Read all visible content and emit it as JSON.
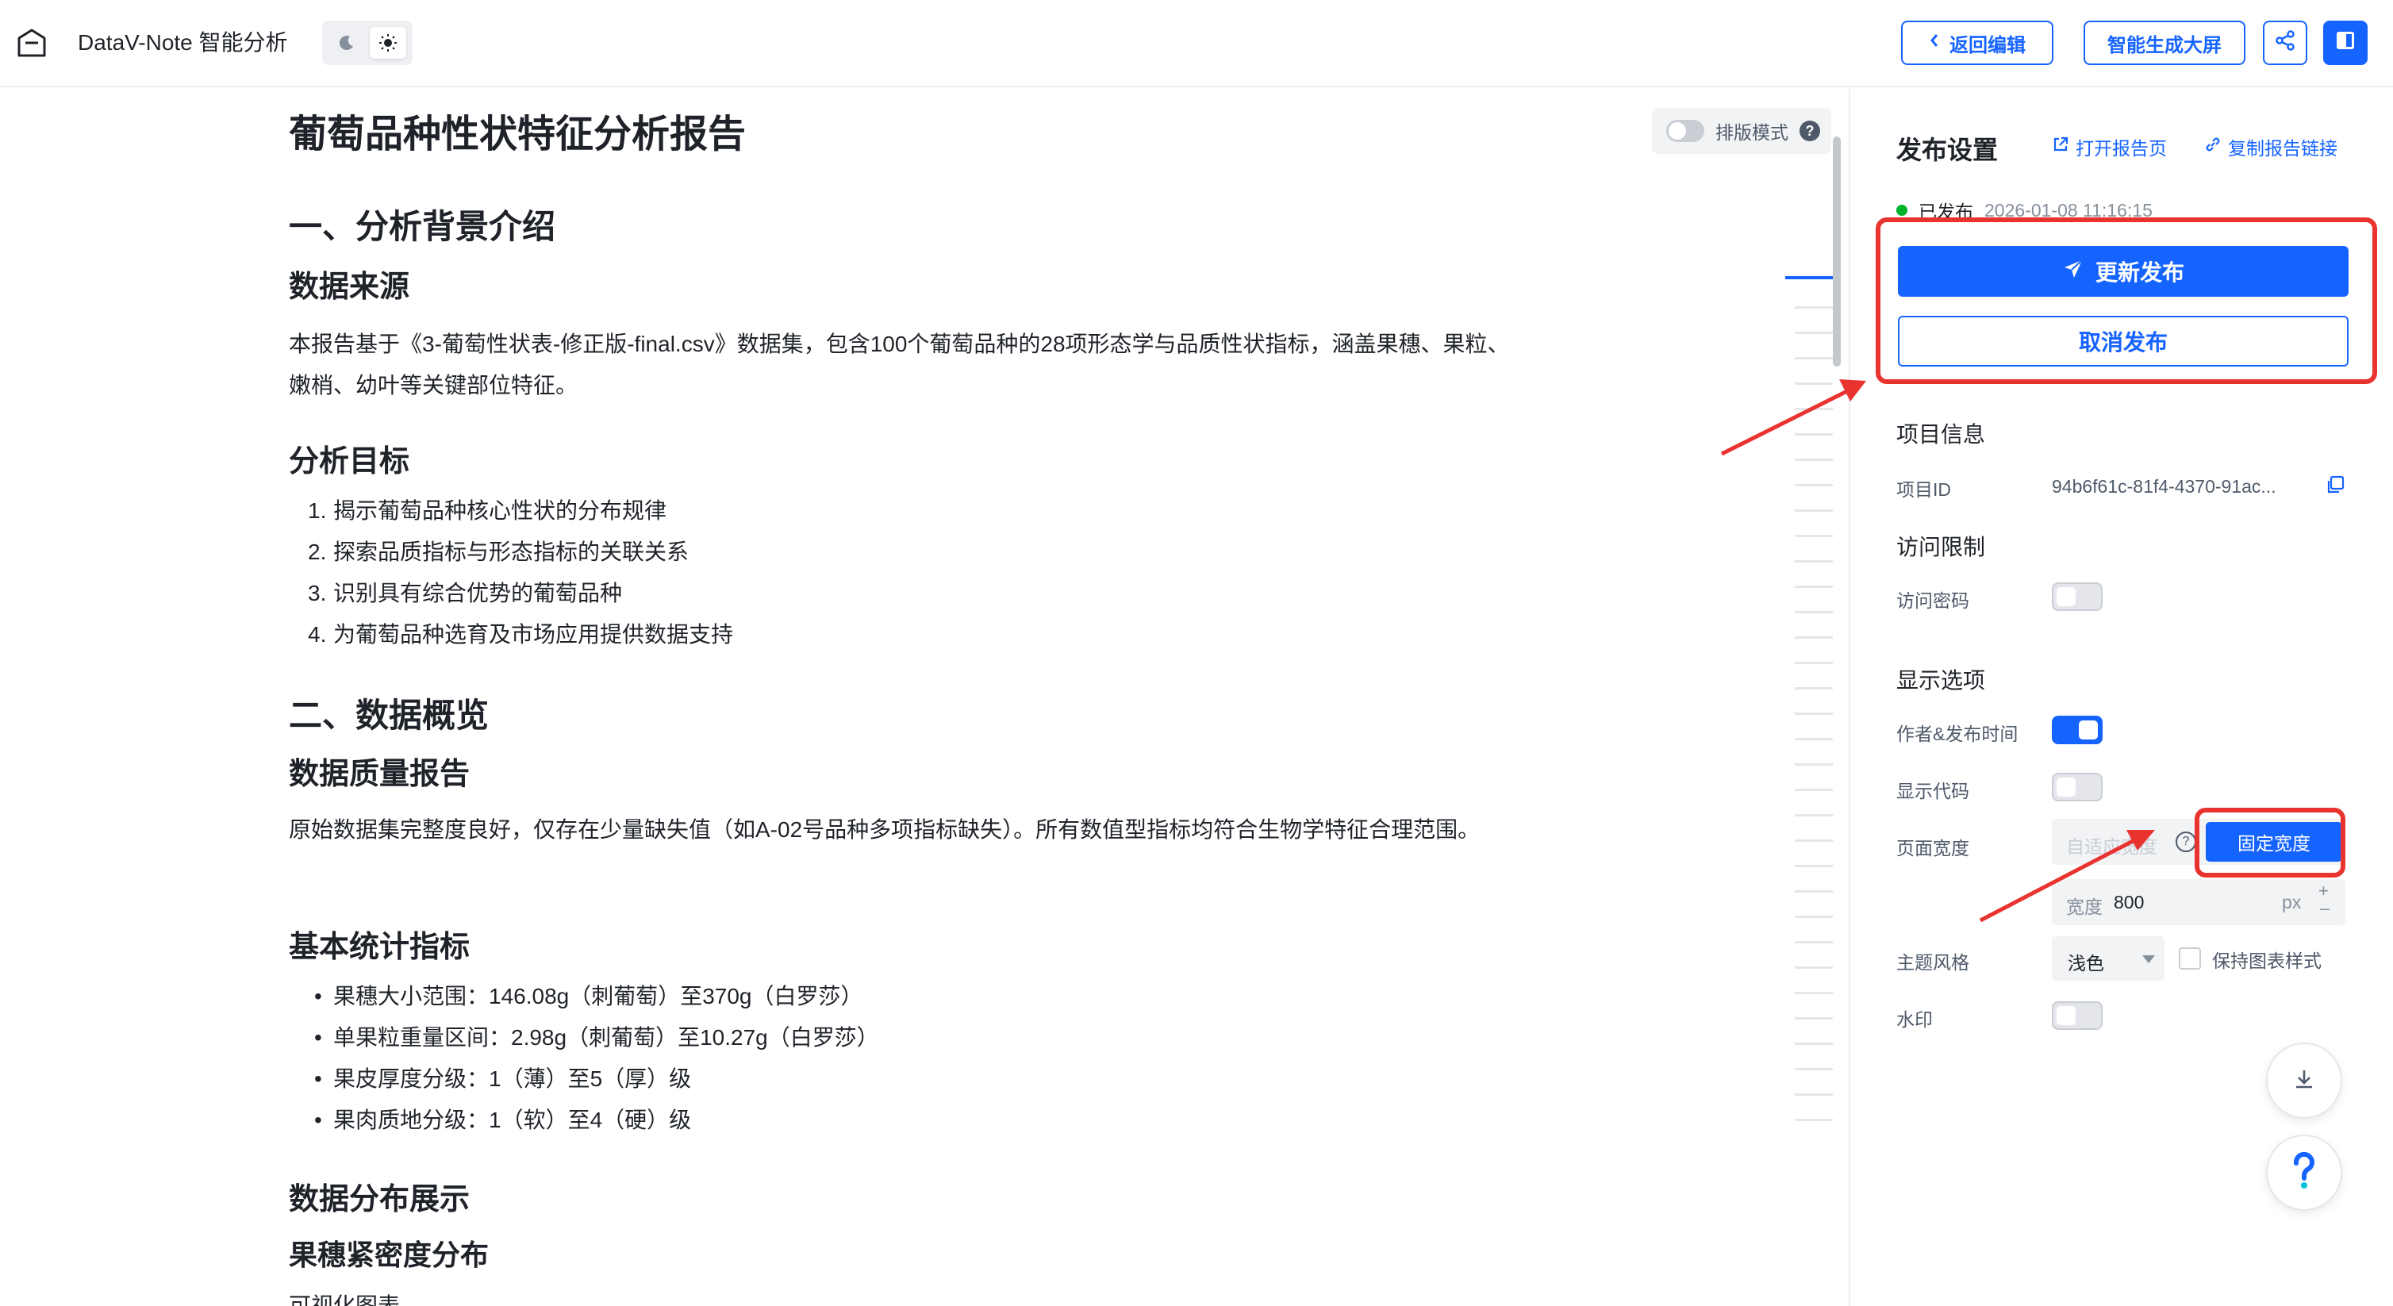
{
  "app": {
    "title": "DataV-Note 智能分析",
    "theme_options": [
      "moon-icon",
      "sun-icon"
    ],
    "theme_selected": "light"
  },
  "toolbar": {
    "back_label": "返回编辑",
    "screen_label": "智能生成大屏",
    "share_icon": "share-icon",
    "panel_icon": "panel-toggle-icon"
  },
  "article": {
    "layout_mode_label": "排版模式",
    "title": "葡萄品种性状特征分析报告",
    "section1": "一、分析背景介绍",
    "source_heading": "数据来源",
    "source_text": "本报告基于《3-葡萄性状表-修正版-final.csv》数据集，包含100个葡萄品种的28项形态学与品质性状指标，涵盖果穗、果粒、嫩梢、幼叶等关键部位特征。",
    "goal_heading": "分析目标",
    "goals": [
      {
        "num": "1.",
        "text": "揭示葡萄品种核心性状的分布规律"
      },
      {
        "num": "2.",
        "text": "探索品质指标与形态指标的关联关系"
      },
      {
        "num": "3.",
        "text": "识别具有综合优势的葡萄品种"
      },
      {
        "num": "4.",
        "text": "为葡萄品种选育及市场应用提供数据支持"
      }
    ],
    "section2": "二、数据概览",
    "quality_heading": "数据质量报告",
    "quality_text": "原始数据集完整度良好，仅存在少量缺失值（如A-02号品种多项指标缺失）。所有数值型指标均符合生物学特征合理范围。",
    "stats_heading": "基本统计指标",
    "stats": [
      "果穗大小范围：146.08g（刺葡萄）至370g（白罗莎）",
      "单果粒重量区间：2.98g（刺葡萄）至10.27g（白罗莎）",
      "果皮厚度分级：1（薄）至5（厚）级",
      "果肉质地分级：1（软）至4（硬）级"
    ],
    "dist_heading": "数据分布展示",
    "density_heading": "果穗紧密度分布",
    "chart_caption": "可视化图表"
  },
  "panel": {
    "title": "发布设置",
    "open_link": "打开报告页",
    "copy_link": "复制报告链接",
    "status_label": "已发布",
    "status_time": "2026-01-08 11:16:15",
    "update_btn": "更新发布",
    "cancel_btn": "取消发布",
    "project_info_title": "项目信息",
    "project_id_label": "项目ID",
    "project_id_value": "94b6f61c-81f4-4370-91ac...",
    "access_title": "访问限制",
    "password_label": "访问密码",
    "display_title": "显示选项",
    "author_label": "作者&发布时间",
    "code_label": "显示代码",
    "page_width_label": "页面宽度",
    "width_auto": "自适应宽度",
    "width_fixed": "固定宽度",
    "width_prefix": "宽度",
    "width_value": "800",
    "width_unit": "px",
    "theme_label": "主题风格",
    "theme_value": "浅色",
    "keep_chart_label": "保持图表样式",
    "watermark_label": "水印",
    "switches": {
      "password": false,
      "author": true,
      "code": false,
      "watermark": false
    }
  },
  "colors": {
    "accent": "#1664ff",
    "annotation": "#e8332f",
    "published": "#00b42a"
  }
}
